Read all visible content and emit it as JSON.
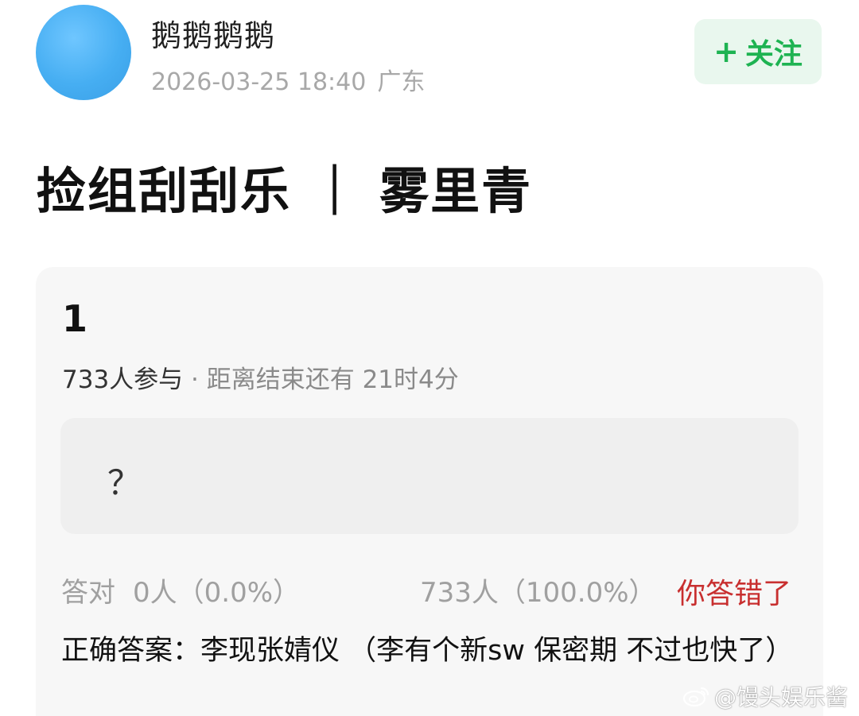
{
  "header": {
    "username": "鹅鹅鹅鹅",
    "datetime": "2026-03-25 18:40",
    "location": "广东",
    "follow": {
      "icon": "+",
      "label": "关注"
    },
    "accent_color": "#1eb352"
  },
  "post": {
    "title": "捡组刮刮乐 ｜ 雾里青"
  },
  "poll": {
    "number": "1",
    "participants": "733人参与",
    "time_left": " · 距离结束还有 21时4分",
    "option": "？",
    "correct_label": "答对",
    "correct_count": "0人（0.0%）",
    "wrong_count": "733人（100.0%）",
    "result_status": "你答错了",
    "answer": "正确答案：李现张婧仪 （李有个新sw 保密期 不过也快了）"
  },
  "watermark": {
    "icon": "weibo-icon",
    "text": "@馒头娱乐酱"
  }
}
